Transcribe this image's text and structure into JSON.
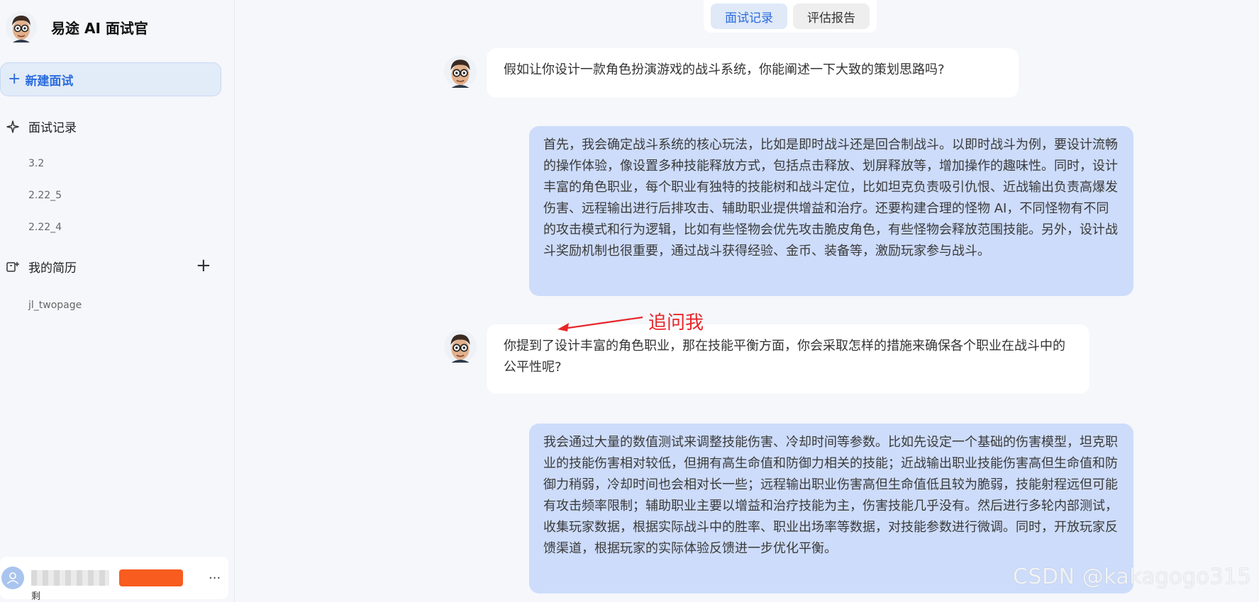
{
  "app": {
    "title": "易途 AI 面试官"
  },
  "sidebar": {
    "new_interview": "新建面试",
    "records_label": "面试记录",
    "records": [
      "3.2",
      "2.22_5",
      "2.22_4"
    ],
    "resume_label": "我的简历",
    "resumes": [
      "jl_twopage"
    ],
    "user_caption": "剩"
  },
  "tabs": [
    {
      "label": "面试记录",
      "active": true
    },
    {
      "label": "评估报告",
      "active": false
    }
  ],
  "messages": [
    {
      "role": "interviewer",
      "text": "假如让你设计一款角色扮演游戏的战斗系统，你能阐述一下大致的策划思路吗?"
    },
    {
      "role": "candidate",
      "text": "首先，我会确定战斗系统的核心玩法，比如是即时战斗还是回合制战斗。以即时战斗为例，要设计流畅的操作体验，像设置多种技能释放方式，包括点击释放、划屏释放等，增加操作的趣味性。同时，设计丰富的角色职业，每个职业有独特的技能树和战斗定位，比如坦克负责吸引仇恨、近战输出负责高爆发伤害、远程输出进行后排攻击、辅助职业提供增益和治疗。还要构建合理的怪物 AI，不同怪物有不同的攻击模式和行为逻辑，比如有些怪物会优先攻击脆皮角色，有些怪物会释放范围技能。另外，设计战斗奖励机制也很重要，通过战斗获得经验、金币、装备等，激励玩家参与战斗。"
    },
    {
      "role": "interviewer",
      "text": "你提到了设计丰富的角色职业，那在技能平衡方面，你会采取怎样的措施来确保各个职业在战斗中的公平性呢?"
    },
    {
      "role": "candidate",
      "text": "我会通过大量的数值测试来调整技能伤害、冷却时间等参数。比如先设定一个基础的伤害模型，坦克职业的技能伤害相对较低，但拥有高生命值和防御力相关的技能；近战输出职业技能伤害高但生命值和防御力稍弱，冷却时间也会相对长一些；远程输出职业伤害高但生命值低且较为脆弱，技能射程远但可能有攻击频率限制；辅助职业主要以增益和治疗技能为主，伤害技能几乎没有。然后进行多轮内部测试，收集玩家数据，根据实际战斗中的胜率、职业出场率等数据，对技能参数进行微调。同时，开放玩家反馈渠道，根据玩家的实际体验反馈进一步优化平衡。"
    }
  ],
  "annotation": {
    "text": "追问我",
    "color": "#e8262a"
  },
  "watermark": "CSDN @kakagogo315",
  "colors": {
    "accent": "#2b6cdd",
    "candidate_bubble": "#cddcfa",
    "badge": "#f85c1e"
  }
}
